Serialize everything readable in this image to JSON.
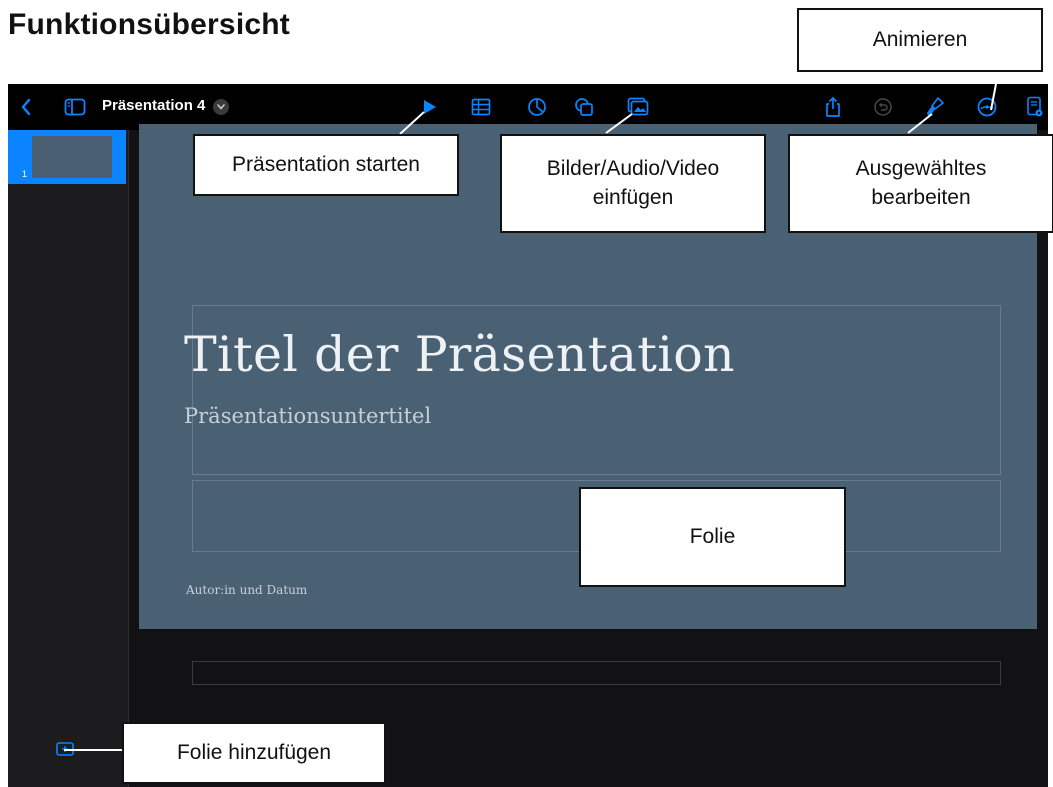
{
  "heading": "Funktionsübersicht",
  "toolbar": {
    "document_title": "Präsentation 4",
    "accent_color": "#0a84ff",
    "icons": [
      "back-chevron",
      "sidebar-toggle",
      "play",
      "table",
      "chart",
      "shape",
      "media",
      "share",
      "undo",
      "format-brush",
      "animate",
      "document-settings"
    ]
  },
  "navigator": {
    "slides": [
      {
        "number": "1",
        "selected": true
      }
    ]
  },
  "slide": {
    "title": "Titel der Präsentation",
    "subtitle": "Präsentationsuntertitel",
    "author": "Autor:in und Datum",
    "background_color": "#4a6073"
  },
  "callouts": {
    "animate": "Animieren",
    "play": "Präsentation starten",
    "media": "Bilder/Audio/Video\neinfügen",
    "format": "Ausgewähltes\nbearbeiten",
    "slide": "Folie",
    "add_slide": "Folie hinzufügen"
  }
}
